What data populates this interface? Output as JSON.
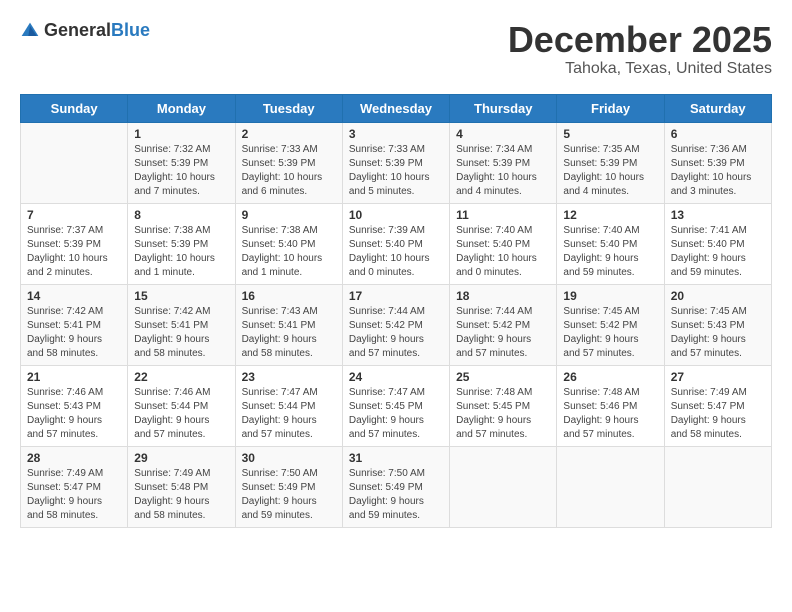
{
  "logo": {
    "text_general": "General",
    "text_blue": "Blue"
  },
  "header": {
    "month_year": "December 2025",
    "location": "Tahoka, Texas, United States"
  },
  "days_of_week": [
    "Sunday",
    "Monday",
    "Tuesday",
    "Wednesday",
    "Thursday",
    "Friday",
    "Saturday"
  ],
  "weeks": [
    [
      {
        "day": "",
        "info": ""
      },
      {
        "day": "1",
        "info": "Sunrise: 7:32 AM\nSunset: 5:39 PM\nDaylight: 10 hours\nand 7 minutes."
      },
      {
        "day": "2",
        "info": "Sunrise: 7:33 AM\nSunset: 5:39 PM\nDaylight: 10 hours\nand 6 minutes."
      },
      {
        "day": "3",
        "info": "Sunrise: 7:33 AM\nSunset: 5:39 PM\nDaylight: 10 hours\nand 5 minutes."
      },
      {
        "day": "4",
        "info": "Sunrise: 7:34 AM\nSunset: 5:39 PM\nDaylight: 10 hours\nand 4 minutes."
      },
      {
        "day": "5",
        "info": "Sunrise: 7:35 AM\nSunset: 5:39 PM\nDaylight: 10 hours\nand 4 minutes."
      },
      {
        "day": "6",
        "info": "Sunrise: 7:36 AM\nSunset: 5:39 PM\nDaylight: 10 hours\nand 3 minutes."
      }
    ],
    [
      {
        "day": "7",
        "info": "Sunrise: 7:37 AM\nSunset: 5:39 PM\nDaylight: 10 hours\nand 2 minutes."
      },
      {
        "day": "8",
        "info": "Sunrise: 7:38 AM\nSunset: 5:39 PM\nDaylight: 10 hours\nand 1 minute."
      },
      {
        "day": "9",
        "info": "Sunrise: 7:38 AM\nSunset: 5:40 PM\nDaylight: 10 hours\nand 1 minute."
      },
      {
        "day": "10",
        "info": "Sunrise: 7:39 AM\nSunset: 5:40 PM\nDaylight: 10 hours\nand 0 minutes."
      },
      {
        "day": "11",
        "info": "Sunrise: 7:40 AM\nSunset: 5:40 PM\nDaylight: 10 hours\nand 0 minutes."
      },
      {
        "day": "12",
        "info": "Sunrise: 7:40 AM\nSunset: 5:40 PM\nDaylight: 9 hours\nand 59 minutes."
      },
      {
        "day": "13",
        "info": "Sunrise: 7:41 AM\nSunset: 5:40 PM\nDaylight: 9 hours\nand 59 minutes."
      }
    ],
    [
      {
        "day": "14",
        "info": "Sunrise: 7:42 AM\nSunset: 5:41 PM\nDaylight: 9 hours\nand 58 minutes."
      },
      {
        "day": "15",
        "info": "Sunrise: 7:42 AM\nSunset: 5:41 PM\nDaylight: 9 hours\nand 58 minutes."
      },
      {
        "day": "16",
        "info": "Sunrise: 7:43 AM\nSunset: 5:41 PM\nDaylight: 9 hours\nand 58 minutes."
      },
      {
        "day": "17",
        "info": "Sunrise: 7:44 AM\nSunset: 5:42 PM\nDaylight: 9 hours\nand 57 minutes."
      },
      {
        "day": "18",
        "info": "Sunrise: 7:44 AM\nSunset: 5:42 PM\nDaylight: 9 hours\nand 57 minutes."
      },
      {
        "day": "19",
        "info": "Sunrise: 7:45 AM\nSunset: 5:42 PM\nDaylight: 9 hours\nand 57 minutes."
      },
      {
        "day": "20",
        "info": "Sunrise: 7:45 AM\nSunset: 5:43 PM\nDaylight: 9 hours\nand 57 minutes."
      }
    ],
    [
      {
        "day": "21",
        "info": "Sunrise: 7:46 AM\nSunset: 5:43 PM\nDaylight: 9 hours\nand 57 minutes."
      },
      {
        "day": "22",
        "info": "Sunrise: 7:46 AM\nSunset: 5:44 PM\nDaylight: 9 hours\nand 57 minutes."
      },
      {
        "day": "23",
        "info": "Sunrise: 7:47 AM\nSunset: 5:44 PM\nDaylight: 9 hours\nand 57 minutes."
      },
      {
        "day": "24",
        "info": "Sunrise: 7:47 AM\nSunset: 5:45 PM\nDaylight: 9 hours\nand 57 minutes."
      },
      {
        "day": "25",
        "info": "Sunrise: 7:48 AM\nSunset: 5:45 PM\nDaylight: 9 hours\nand 57 minutes."
      },
      {
        "day": "26",
        "info": "Sunrise: 7:48 AM\nSunset: 5:46 PM\nDaylight: 9 hours\nand 57 minutes."
      },
      {
        "day": "27",
        "info": "Sunrise: 7:49 AM\nSunset: 5:47 PM\nDaylight: 9 hours\nand 58 minutes."
      }
    ],
    [
      {
        "day": "28",
        "info": "Sunrise: 7:49 AM\nSunset: 5:47 PM\nDaylight: 9 hours\nand 58 minutes."
      },
      {
        "day": "29",
        "info": "Sunrise: 7:49 AM\nSunset: 5:48 PM\nDaylight: 9 hours\nand 58 minutes."
      },
      {
        "day": "30",
        "info": "Sunrise: 7:50 AM\nSunset: 5:49 PM\nDaylight: 9 hours\nand 59 minutes."
      },
      {
        "day": "31",
        "info": "Sunrise: 7:50 AM\nSunset: 5:49 PM\nDaylight: 9 hours\nand 59 minutes."
      },
      {
        "day": "",
        "info": ""
      },
      {
        "day": "",
        "info": ""
      },
      {
        "day": "",
        "info": ""
      }
    ]
  ]
}
